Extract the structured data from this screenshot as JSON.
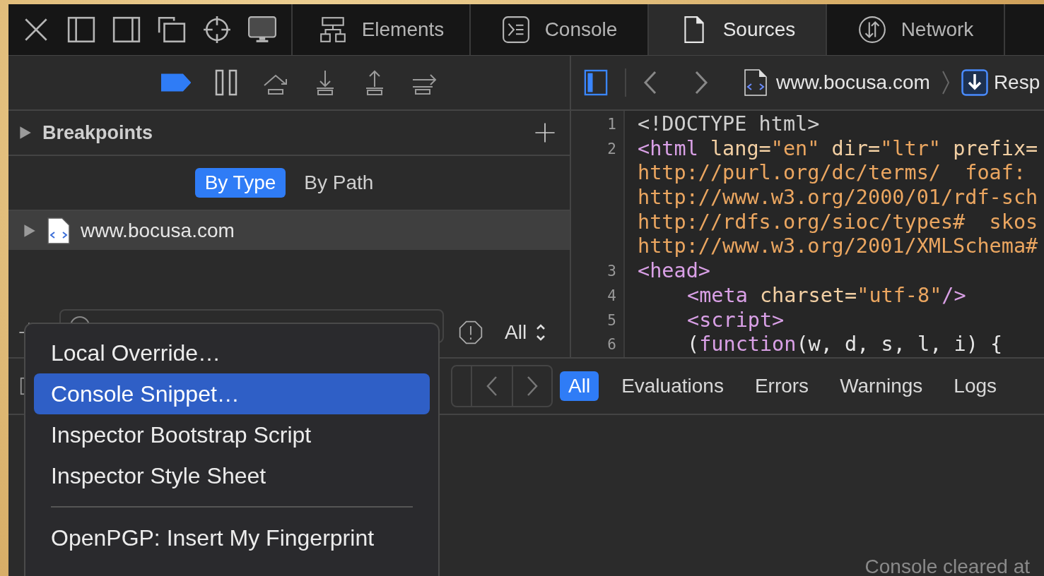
{
  "tab_bar": {
    "tabs": [
      {
        "label": "Elements",
        "selected": false
      },
      {
        "label": "Console",
        "selected": false
      },
      {
        "label": "Sources",
        "selected": true
      },
      {
        "label": "Network",
        "selected": false
      }
    ]
  },
  "debugger_toolbar": {
    "breakpoints_active": true
  },
  "breakpoints": {
    "title": "Breakpoints",
    "expanded": false
  },
  "group_by": [
    {
      "label": "By Type",
      "selected": true
    },
    {
      "label": "By Path",
      "selected": false
    }
  ],
  "resources": [
    {
      "name": "www.bocusa.com",
      "selected": true,
      "expanded": false
    }
  ],
  "filter": {
    "scope": "All"
  },
  "editor_bar": {
    "navigator_shown": true,
    "breadcrumbs": [
      "www.bocusa.com",
      "Resp"
    ]
  },
  "code": [
    {
      "number": "1",
      "indented": false,
      "tokens": [
        {
          "kind": "doctype",
          "text": "<!DOCTYPE html>"
        }
      ]
    },
    {
      "number": "2",
      "indented": false,
      "tokens": [
        {
          "kind": "tag",
          "text": "<html"
        },
        {
          "kind": "attr",
          "text": " lang="
        },
        {
          "kind": "string",
          "text": "\"en\""
        },
        {
          "kind": "attr",
          "text": " dir="
        },
        {
          "kind": "string",
          "text": "\"ltr\""
        },
        {
          "kind": "attr",
          "text": " prefix="
        }
      ]
    },
    {
      "indented": false,
      "tokens": [
        {
          "kind": "string",
          "text": "http://purl.org/dc/terms/  foaf:"
        }
      ]
    },
    {
      "indented": false,
      "tokens": [
        {
          "kind": "string",
          "text": "http://www.w3.org/2000/01/rdf-sch"
        }
      ]
    },
    {
      "indented": false,
      "tokens": [
        {
          "kind": "string",
          "text": "http://rdfs.org/sioc/types#  skos"
        }
      ]
    },
    {
      "indented": false,
      "tokens": [
        {
          "kind": "string",
          "text": "http://www.w3.org/2001/XMLSchema#"
        }
      ]
    },
    {
      "number": "3",
      "indented": false,
      "tokens": [
        {
          "kind": "tag",
          "text": "<head>"
        }
      ]
    },
    {
      "number": "4",
      "indented": true,
      "tokens": [
        {
          "kind": "tag",
          "text": "<meta"
        },
        {
          "kind": "attr",
          "text": " charset="
        },
        {
          "kind": "string",
          "text": "\"utf-8\""
        },
        {
          "kind": "tag",
          "text": "/>"
        }
      ]
    },
    {
      "number": "5",
      "indented": true,
      "tokens": [
        {
          "kind": "tag",
          "text": "<script>"
        }
      ]
    },
    {
      "number": "6",
      "indented": true,
      "tokens": [
        {
          "kind": "plain",
          "text": "("
        },
        {
          "kind": "keyword",
          "text": "function"
        },
        {
          "kind": "plain",
          "text": "(w, d, s, l, i) {"
        }
      ]
    }
  ],
  "console_tabs": [
    {
      "label": "All",
      "selected": true
    },
    {
      "label": "Evaluations",
      "selected": false
    },
    {
      "label": "Errors",
      "selected": false
    },
    {
      "label": "Warnings",
      "selected": false
    },
    {
      "label": "Logs",
      "selected": false
    }
  ],
  "console": {
    "message": "Console cleared at"
  },
  "menu": {
    "items": [
      {
        "kind": "item",
        "label": "Local Override…",
        "selected": false
      },
      {
        "kind": "item",
        "label": "Console Snippet…",
        "selected": true
      },
      {
        "kind": "item",
        "label": "Inspector Bootstrap Script",
        "selected": false
      },
      {
        "kind": "item",
        "label": "Inspector Style Sheet",
        "selected": false
      },
      {
        "kind": "separator"
      },
      {
        "kind": "item",
        "label": "OpenPGP: Insert My Fingerprint",
        "selected": false
      }
    ]
  }
}
